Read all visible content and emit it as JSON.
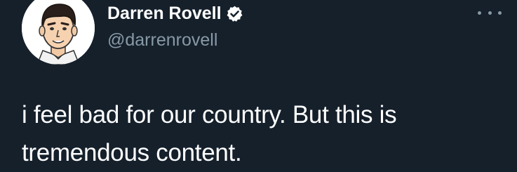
{
  "author": {
    "display_name": "Darren Rovell",
    "handle": "@darrenrovell",
    "verified": true
  },
  "icons": {
    "verified": "verified-badge-icon",
    "more": "more-options-icon"
  },
  "tweet": {
    "text": "i feel bad for our country. But this is tremendous content."
  },
  "colors": {
    "background": "#15202b",
    "text": "#ffffff",
    "secondary_text": "#8899a6"
  }
}
